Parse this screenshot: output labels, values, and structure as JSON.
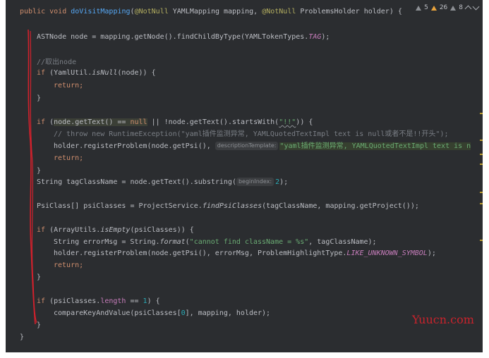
{
  "editor": {
    "code": {
      "l1": {
        "kw1": "public void ",
        "fn": "doVisitMapping",
        "p1": "(",
        "an1": "@NotNull",
        "p2": " YAMLMapping mapping, ",
        "an2": "@NotNull",
        "p3": " ProblemsHolder holder) {"
      },
      "l2": {
        "a": "ASTNode node = mapping.getNode().findChildByType(YAMLTokenTypes.",
        "c": "TAG",
        "b": ");"
      },
      "l3": {
        "cm": "//取出node"
      },
      "l4": {
        "kw": "if ",
        "a": "(YamlUtil.",
        "it": "isNull",
        "b": "(node)) {"
      },
      "l5": {
        "kw": "return;"
      },
      "l6": {
        "a": "}"
      },
      "l7": {
        "kw": "if ",
        "a": "(",
        "hl": "node.getText() == ",
        "nul": "null",
        "b": " || !node.getText().startsWith(",
        "s": "\"!!\"",
        "c": ")) {"
      },
      "l8": {
        "cm": "// throw new RuntimeException(\"yaml插件监测异常, YAMLQuotedTextImpl text is null或者不是!!开头\");"
      },
      "l9": {
        "a": "holder.registerProblem(node.getPsi(), ",
        "hint": "descriptionTemplate:",
        "s": "\"yaml插件监测异常, YAMLQuotedTextImpl text is n"
      },
      "l10": {
        "kw": "return;"
      },
      "l11": {
        "a": "}"
      },
      "l12": {
        "a": "String tagClassName = node.getText().substring(",
        "hint": "beginIndex:",
        "n": "2",
        "b": ");"
      },
      "l13": {
        "a": "PsiClass[] psiClasses = ProjectService.",
        "it": "findPsiClasses",
        "b": "(tagClassName, mapping.getProject());"
      },
      "l14": {
        "kw": "if ",
        "a": "(ArrayUtils.",
        "it": "isEmpty",
        "b": "(psiClasses)) {"
      },
      "l15": {
        "a": "String errorMsg = String.",
        "it": "format",
        "p": "(",
        "s": "\"cannot find className = %s\"",
        "b": ", tagClassName);"
      },
      "l16": {
        "a": "holder.registerProblem(node.getPsi(), errorMsg, ProblemHighlightType.",
        "cst": "LIKE_UNKNOWN_SYMBOL",
        "b": ");"
      },
      "l17": {
        "kw": "return;"
      },
      "l18": {
        "a": "}"
      },
      "l19": {
        "kw": "if ",
        "a": "(psiClasses.",
        "f": "length",
        "b": " == ",
        "n": "1",
        "c": ") {"
      },
      "l20": {
        "a": "compareKeyAndValue(psiClasses[",
        "n": "0",
        "b": "], mapping, holder);"
      },
      "l21": {
        "a": "}"
      },
      "l22": {
        "a": "}"
      }
    },
    "inspections": {
      "warn1": "5",
      "warn2": "26",
      "weak": "8"
    },
    "icons": {
      "warning": "warning-triangle-icon",
      "chevron_up": "chevron-up-icon",
      "chevron_down": "chevron-down-icon"
    },
    "colors": {
      "background": "#2b2d30",
      "keyword": "#cf8e6d",
      "function": "#56a8f5",
      "annotation": "#b3ae60",
      "string": "#6aab73",
      "number": "#2aacb8",
      "comment": "#7a7e85",
      "constant": "#c77dbb",
      "annotation_mark": "#d0212c"
    }
  },
  "watermark": {
    "text": "Yuucn.com"
  }
}
